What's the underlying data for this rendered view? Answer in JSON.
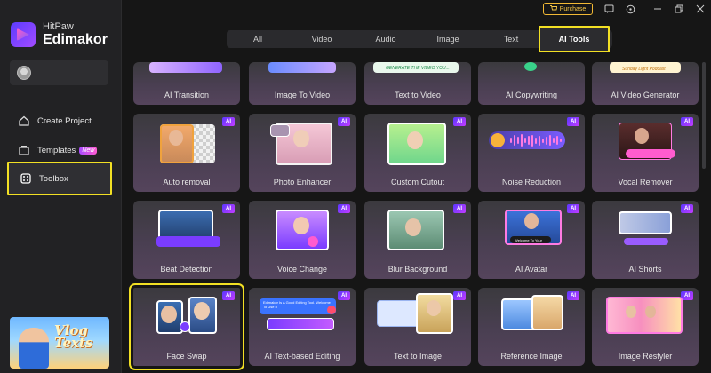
{
  "brand": {
    "line1": "HitPaw",
    "line2": "Edimakor"
  },
  "sidebar": {
    "create_project": "Create Project",
    "templates": "Templates",
    "templates_badge": "New",
    "toolbox": "Toolbox"
  },
  "promo": {
    "line1": "Vlog",
    "line2": "Texts"
  },
  "topbar": {
    "purchase_label": "Purchase"
  },
  "tabs": [
    "All",
    "Video",
    "Audio",
    "Image",
    "Text",
    "AI Tools"
  ],
  "active_tab": "AI Tools",
  "ai_badge": "AI",
  "tools_row0": [
    "AI Transition",
    "Image To Video",
    "Text to Video",
    "AI Copywriting",
    "AI Video Generator"
  ],
  "tools_row0_snippets": {
    "text_to_video": "GENERATE THE VIDEO YOU...",
    "video_generator": "Sunday Light Podcast"
  },
  "tools_row1": [
    "Auto removal",
    "Photo Enhancer",
    "Custom Cutout",
    "Noise Reduction",
    "Vocal Remover"
  ],
  "tools_row2": [
    "Beat Detection",
    "Voice Change",
    "Blur Background",
    "AI Avatar",
    "AI Shorts"
  ],
  "tools_row2_snippets": {
    "avatar_caption": "Welcome To Your"
  },
  "tools_row3": [
    "Face Swap",
    "AI Text-based Editing",
    "Text to Image",
    "Reference Image",
    "Image Restyler"
  ],
  "tools_row3_snippets": {
    "text_editing": "Edimakor Is A Good Editing Tool. Welcome To Use It"
  },
  "colors": {
    "highlight": "#f2e024",
    "accent": "#7a3cff",
    "purchase": "#f2b935"
  }
}
